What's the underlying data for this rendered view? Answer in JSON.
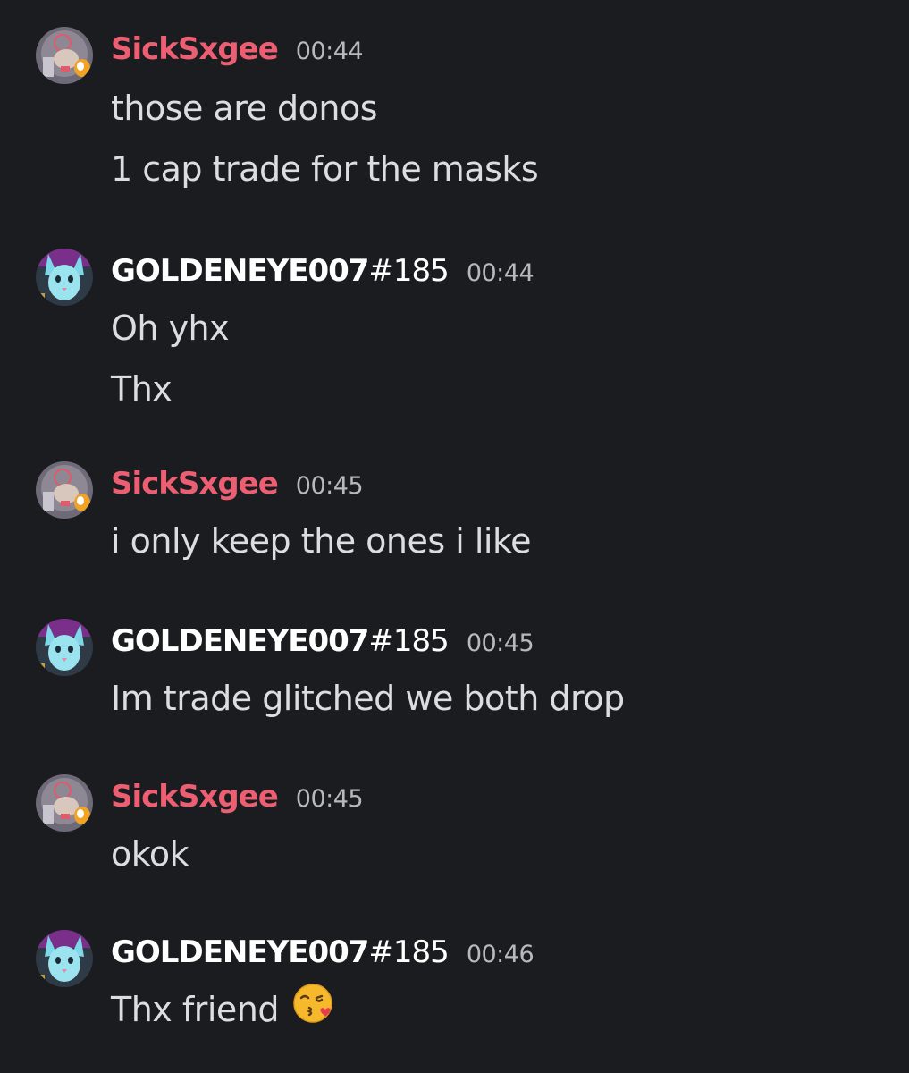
{
  "colors": {
    "background": "#1b1c20",
    "username_pink": "#ec5f72",
    "username_white": "#ffffff",
    "timestamp": "#b7b9bf",
    "message_text": "#dcdde1"
  },
  "messages": [
    {
      "author": "SickSxgee",
      "discriminator": "",
      "avatar_icon": "user-avatar-sicksxgee",
      "time": "00:44",
      "lines": [
        "those are donos",
        "1 cap trade for the masks"
      ]
    },
    {
      "author": "GOLDENEYE007",
      "discriminator": "#185",
      "avatar_icon": "user-avatar-cat",
      "time": "00:44",
      "lines": [
        "Oh yhx",
        "Thx"
      ]
    },
    {
      "author": "SickSxgee",
      "discriminator": "",
      "avatar_icon": "user-avatar-sicksxgee",
      "time": "00:45",
      "lines": [
        "i only keep the ones i like"
      ]
    },
    {
      "author": "GOLDENEYE007",
      "discriminator": "#185",
      "avatar_icon": "user-avatar-cat",
      "time": "00:45",
      "lines": [
        "Im trade glitched we both drop"
      ]
    },
    {
      "author": "SickSxgee",
      "discriminator": "",
      "avatar_icon": "user-avatar-sicksxgee",
      "time": "00:45",
      "lines": [
        "okok"
      ]
    },
    {
      "author": "GOLDENEYE007",
      "discriminator": "#185",
      "avatar_icon": "user-avatar-cat",
      "time": "00:46",
      "lines": [
        "Thx friend"
      ],
      "emoji": "face-blowing-a-kiss-emoji"
    }
  ]
}
